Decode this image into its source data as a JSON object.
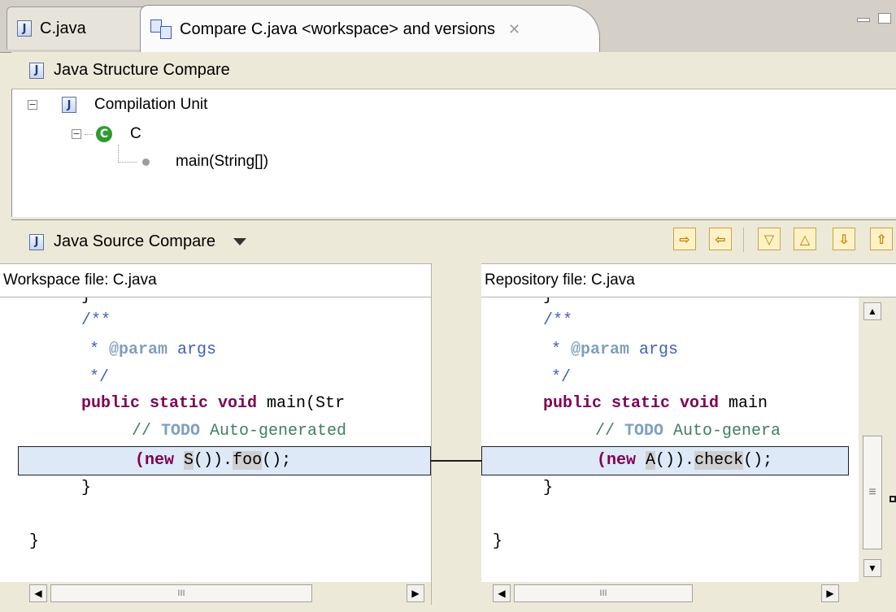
{
  "tabs": [
    {
      "label": "C.java",
      "icon": "java-file-icon",
      "active": false
    },
    {
      "label": "Compare C.java <workspace> and versions",
      "icon": "compare-icon",
      "active": true,
      "close": "✕"
    }
  ],
  "structure_compare": {
    "title": "Java Structure Compare",
    "tree": [
      {
        "label": "Compilation Unit",
        "toggle": "−"
      },
      {
        "label": "C",
        "toggle": "−",
        "icon_letter": "C"
      },
      {
        "label": "main(String[])"
      }
    ]
  },
  "source_compare": {
    "title": "Java Source Compare",
    "toolbar": [
      "copy-all-left-to-right",
      "copy-right-to-left",
      "next-difference",
      "previous-difference",
      "next-change",
      "previous-change"
    ]
  },
  "left_editor": {
    "header": "Workspace file: C.java",
    "lines": {
      "l0": "}",
      "l1": "/**",
      "l2_star": "* ",
      "l2_tag": "@param",
      "l2_rest": " args",
      "l3": "*/",
      "l4_kw": "public static void",
      "l4_rest": " main(Str",
      "l5_cm": "// ",
      "l5_todo": "TODO",
      "l5_rest": " Auto-generated",
      "l6_kw": "(new",
      "l6_sp": " ",
      "l6_chg": "S",
      "l6_mid": "()).",
      "l6_chg2": "foo",
      "l6_end": "();",
      "l7": "}",
      "l8": "}"
    }
  },
  "right_editor": {
    "header": "Repository file: C.java",
    "lines": {
      "l0": "}",
      "l1": "/**",
      "l2_star": "* ",
      "l2_tag": "@param",
      "l2_rest": " args",
      "l3": "*/",
      "l4_kw": "public static void",
      "l4_rest": " main",
      "l5_cm": "// ",
      "l5_todo": "TODO",
      "l5_rest": " Auto-genera",
      "l6_kw": "(new",
      "l6_sp": " ",
      "l6_chg": "A",
      "l6_mid": "()).",
      "l6_chg2": "check",
      "l6_end": "();",
      "l7": "}",
      "l8": "}"
    }
  },
  "scroll": {
    "thumb_grip": "III",
    "vthumb_grip": "≡"
  }
}
